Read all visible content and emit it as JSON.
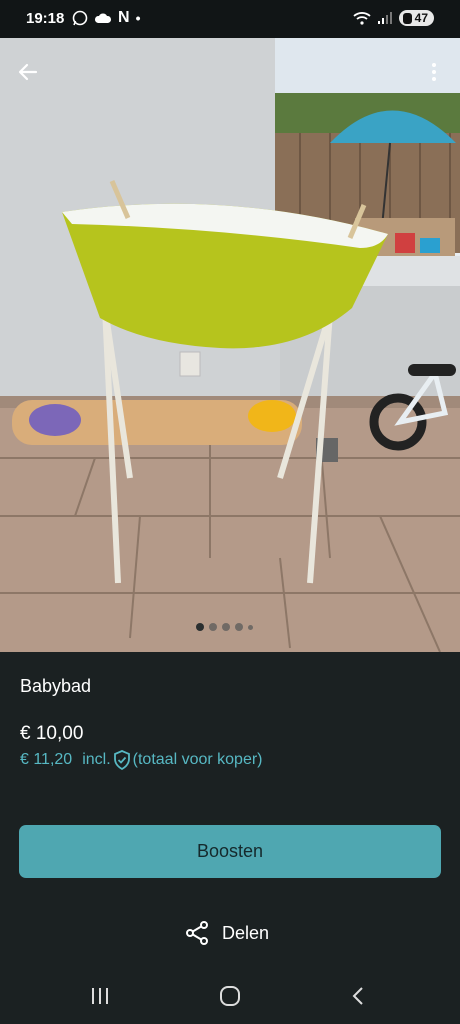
{
  "status_bar": {
    "time": "19:18",
    "notification_icons": [
      "whatsapp-icon",
      "weather-icon",
      "n-app-icon",
      "dot-icon"
    ],
    "system_icons": [
      "wifi-icon",
      "signal-icon"
    ],
    "battery": "47"
  },
  "listing": {
    "title": "Babybad",
    "price": "€ 10,00",
    "price_incl": "€ 11,20",
    "incl_label": "incl.",
    "buyer_note": "(totaal voor koper)"
  },
  "gallery": {
    "photo_count": 5,
    "active_index": 0
  },
  "actions": {
    "boost_label": "Boosten",
    "share_label": "Delen"
  },
  "colors": {
    "background": "#1b2122",
    "accent": "#4fa7b1",
    "price_incl": "#57b8c3"
  },
  "nav": {
    "icons": [
      "recent-apps-icon",
      "home-icon",
      "back-nav-icon"
    ]
  }
}
